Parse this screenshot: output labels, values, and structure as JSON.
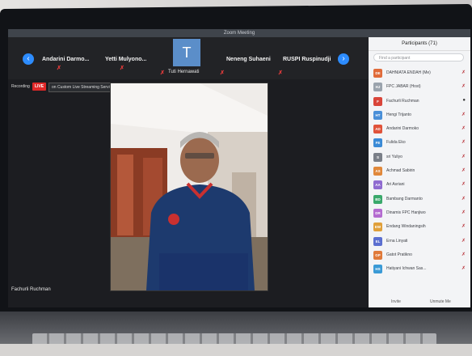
{
  "window": {
    "title": "Zoom Meeting"
  },
  "gallery": {
    "tiles": [
      {
        "name": "Andarini Darmo..."
      },
      {
        "name": "Yetti Mulyono..."
      },
      {
        "name": "Neneng Suhaeni"
      },
      {
        "name": "RUSPI Ruspinudji"
      }
    ],
    "avatar_letter": "T",
    "avatar_name": "Tuti Hernawati"
  },
  "status": {
    "recording": "Recording",
    "live": "LIVE",
    "stream": "on Custom Live Streaming Service"
  },
  "speaker": {
    "label": "Fachurli Ruchman"
  },
  "participants": {
    "title": "Participants (71)",
    "search_placeholder": "Find a participant",
    "list": [
      {
        "initials": "DE",
        "name": "DAHNIATA ENDAH (Me)",
        "color": "#e06b3a"
      },
      {
        "initials": "HJ",
        "name": "FPC JABAR (Host)",
        "color": "#9aa3ad"
      },
      {
        "initials": "F",
        "name": "Fachurli Ruchman",
        "color": "#d9453a"
      },
      {
        "initials": "HT",
        "name": "Hengi Trijanto",
        "color": "#4a8fd8"
      },
      {
        "initials": "AD",
        "name": "Andarini Darmoko",
        "color": "#e0533a"
      },
      {
        "initials": "FE",
        "name": "Fulida Eko",
        "color": "#3a8ad6"
      },
      {
        "initials": "S",
        "name": "sri Yuliyo",
        "color": "#7a7f88"
      },
      {
        "initials": "AS",
        "name": "Achmad Sabirin",
        "color": "#e0883a"
      },
      {
        "initials": "AA",
        "name": "Ari Asriani",
        "color": "#8f6bd0"
      },
      {
        "initials": "BD",
        "name": "Bambang Darmanto",
        "color": "#3aa86b"
      },
      {
        "initials": "DR",
        "name": "Dinamis FPC Hanjiwo",
        "color": "#b46bd0"
      },
      {
        "initials": "EW",
        "name": "Endang Windaningsih",
        "color": "#e0a03a"
      },
      {
        "initials": "EL",
        "name": "Erna Linyati",
        "color": "#5b6fd0"
      },
      {
        "initials": "GP",
        "name": "Gatot Pratikno",
        "color": "#e07a3a"
      },
      {
        "initials": "HS",
        "name": "Hatiyani Ichwan Sas...",
        "color": "#3a9ad6"
      }
    ],
    "invite": "Invite",
    "unmute": "Unmute Me"
  }
}
